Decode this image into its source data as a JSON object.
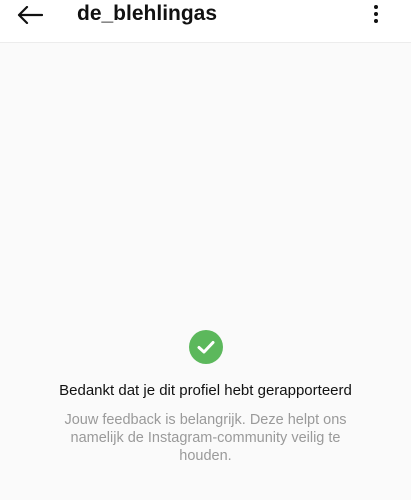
{
  "header": {
    "username": "de_blehlingas",
    "back_icon": "back-arrow-icon",
    "more_icon": "more-vertical-icon"
  },
  "confirmation": {
    "icon": "check-circle-icon",
    "icon_color": "#5cb85c",
    "title": "Bedankt dat je dit profiel hebt gerapporteerd",
    "message": "Jouw feedback is belangrijk. Deze helpt ons namelijk de Instagram-community veilig te houden."
  }
}
